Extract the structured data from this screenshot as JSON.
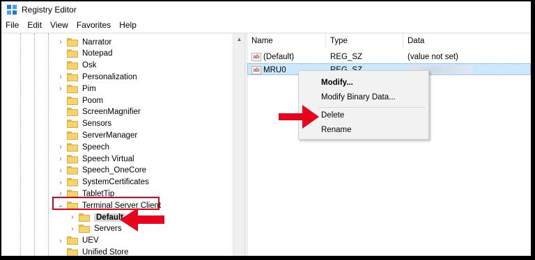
{
  "window": {
    "title": "Registry Editor"
  },
  "menu": [
    "File",
    "Edit",
    "View",
    "Favorites",
    "Help"
  ],
  "tree": {
    "items": [
      {
        "label": "Narrator",
        "indent": 1,
        "chevron": "right"
      },
      {
        "label": "Notepad",
        "indent": 1,
        "chevron": "none"
      },
      {
        "label": "Osk",
        "indent": 1,
        "chevron": "none"
      },
      {
        "label": "Personalization",
        "indent": 1,
        "chevron": "right"
      },
      {
        "label": "Pim",
        "indent": 1,
        "chevron": "right"
      },
      {
        "label": "Poom",
        "indent": 1,
        "chevron": "none"
      },
      {
        "label": "ScreenMagnifier",
        "indent": 1,
        "chevron": "none"
      },
      {
        "label": "Sensors",
        "indent": 1,
        "chevron": "none"
      },
      {
        "label": "ServerManager",
        "indent": 1,
        "chevron": "none"
      },
      {
        "label": "Speech",
        "indent": 1,
        "chevron": "right"
      },
      {
        "label": "Speech Virtual",
        "indent": 1,
        "chevron": "right"
      },
      {
        "label": "Speech_OneCore",
        "indent": 1,
        "chevron": "right"
      },
      {
        "label": "SystemCertificates",
        "indent": 1,
        "chevron": "right"
      },
      {
        "label": "TabletTip",
        "indent": 1,
        "chevron": "right"
      },
      {
        "label": "Terminal Server Client",
        "indent": 1,
        "chevron": "down"
      },
      {
        "label": "Default",
        "indent": 2,
        "chevron": "right",
        "selected": true
      },
      {
        "label": "Servers",
        "indent": 2,
        "chevron": "right"
      },
      {
        "label": "UEV",
        "indent": 1,
        "chevron": "right"
      },
      {
        "label": "Unified Store",
        "indent": 1,
        "chevron": "none"
      }
    ]
  },
  "list": {
    "columns": [
      "Name",
      "Type",
      "Data"
    ],
    "rows": [
      {
        "name": "(Default)",
        "type": "REG_SZ",
        "data": "(value not set)",
        "selected": false
      },
      {
        "name": "MRU0",
        "type": "REG_SZ",
        "data": "",
        "selected": true
      }
    ]
  },
  "context_menu": {
    "items": [
      "Modify...",
      "Modify Binary Data...",
      "Delete",
      "Rename"
    ]
  },
  "colors": {
    "highlight_box": "#e0001b",
    "arrow": "#e8001c",
    "row_selected": "#cce8ff"
  }
}
